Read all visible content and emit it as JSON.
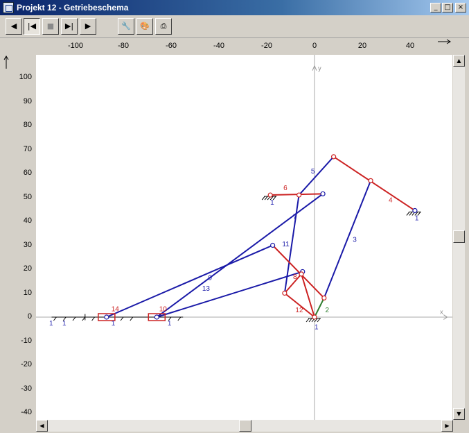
{
  "window": {
    "title": "Projekt 12 - Getriebeschema",
    "minimize": "_",
    "maximize": "□",
    "close": "×"
  },
  "toolbar": {
    "buttons": [
      {
        "name": "step-back-button",
        "glyph": "◀"
      },
      {
        "name": "jump-start-button",
        "glyph": "|◀"
      },
      {
        "name": "stop-button",
        "glyph": "■"
      },
      {
        "name": "jump-end-button",
        "glyph": "▶|"
      },
      {
        "name": "play-button",
        "glyph": "▶"
      },
      {
        "name": "settings-wrench-button",
        "glyph": "🔧"
      },
      {
        "name": "colors-palette-button",
        "glyph": "🎨"
      },
      {
        "name": "print-button",
        "glyph": "⎙"
      }
    ]
  },
  "rulers": {
    "x_ticks": [
      "-100",
      "-80",
      "-60",
      "-40",
      "-20",
      "0",
      "20",
      "40"
    ],
    "y_ticks": [
      "100",
      "90",
      "80",
      "70",
      "60",
      "50",
      "40",
      "30",
      "20",
      "10",
      "0",
      "-10",
      "-20",
      "-30",
      "-40"
    ]
  },
  "axes": {
    "x_label": "x",
    "y_label": "y"
  },
  "links": [
    {
      "id": "1",
      "color": "#2b2bb3"
    },
    {
      "id": "2",
      "color": "#2e7d2e"
    },
    {
      "id": "3",
      "color": "#1a1aa8"
    },
    {
      "id": "4",
      "color": "#cc2222"
    },
    {
      "id": "5",
      "color": "#1a1aa8"
    },
    {
      "id": "6",
      "color": "#cc2222"
    },
    {
      "id": "7",
      "color": "#1a1aa8"
    },
    {
      "id": "8",
      "color": "#cc2222"
    },
    {
      "id": "9",
      "color": "#1a1aa8"
    },
    {
      "id": "10",
      "color": "#cc2222"
    },
    {
      "id": "11",
      "color": "#1a1aa8"
    },
    {
      "id": "12",
      "color": "#cc2222"
    },
    {
      "id": "13",
      "color": "#1a1aa8"
    },
    {
      "id": "14",
      "color": "#cc2222"
    }
  ],
  "scrollbars": {
    "up": "▲",
    "down": "▼",
    "left": "◀",
    "right": "▶"
  }
}
